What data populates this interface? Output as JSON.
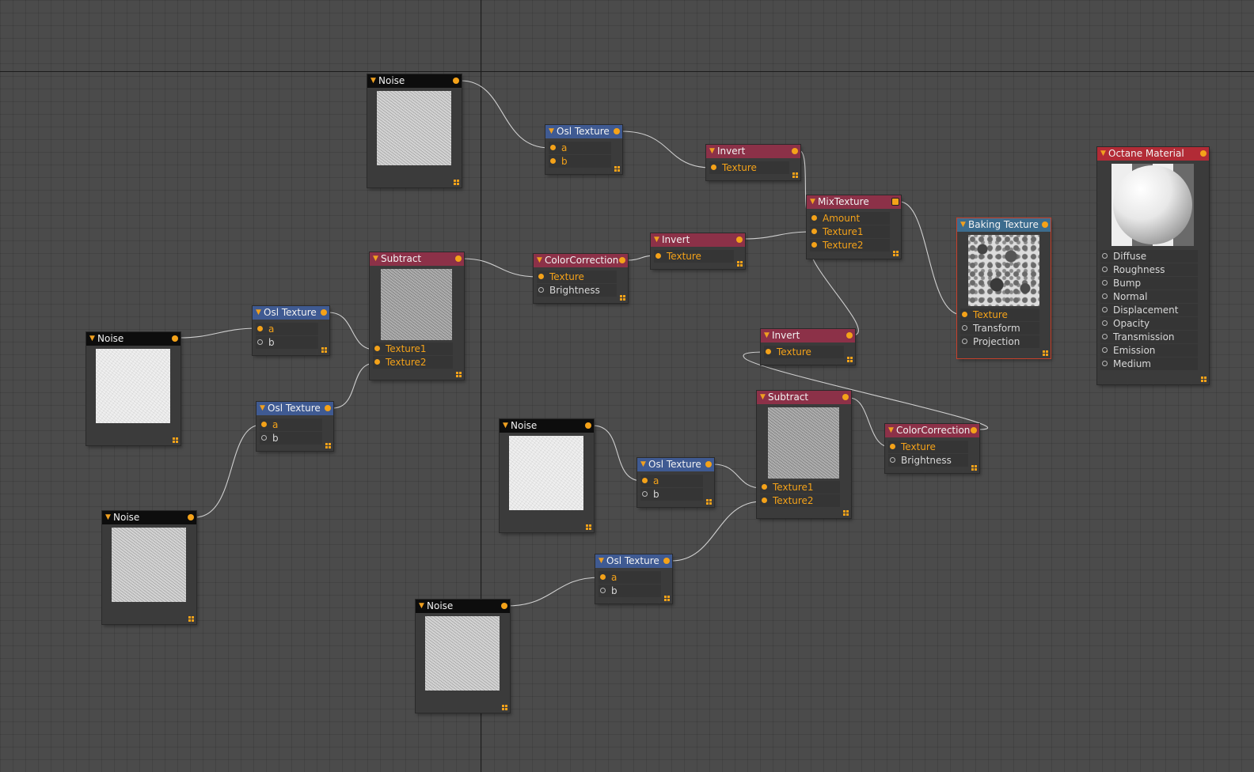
{
  "nodes": {
    "noise_a": {
      "title": "Noise"
    },
    "noise_b": {
      "title": "Noise"
    },
    "noise_c": {
      "title": "Noise"
    },
    "noise_d": {
      "title": "Noise"
    },
    "noise_e": {
      "title": "Noise"
    },
    "osl_top": {
      "title": "Osl Texture",
      "inputs": [
        "a",
        "b"
      ]
    },
    "osl_left1": {
      "title": "Osl Texture",
      "inputs": [
        "a",
        "b"
      ]
    },
    "osl_left2": {
      "title": "Osl Texture",
      "inputs": [
        "a",
        "b"
      ]
    },
    "osl_mid": {
      "title": "Osl Texture",
      "inputs": [
        "a",
        "b"
      ]
    },
    "osl_bottom": {
      "title": "Osl Texture",
      "inputs": [
        "a",
        "b"
      ]
    },
    "subtract_left": {
      "title": "Subtract",
      "inputs": [
        "Texture1",
        "Texture2"
      ]
    },
    "subtract_right": {
      "title": "Subtract",
      "inputs": [
        "Texture1",
        "Texture2"
      ]
    },
    "colorcorr_left": {
      "title": "ColorCorrection",
      "inputs": [
        "Texture",
        "Brightness"
      ]
    },
    "colorcorr_right": {
      "title": "ColorCorrection",
      "inputs": [
        "Texture",
        "Brightness"
      ]
    },
    "invert_top": {
      "title": "Invert",
      "inputs": [
        "Texture"
      ]
    },
    "invert_mid": {
      "title": "Invert",
      "inputs": [
        "Texture"
      ]
    },
    "invert_low": {
      "title": "Invert",
      "inputs": [
        "Texture"
      ]
    },
    "mixtexture": {
      "title": "MixTexture",
      "inputs": [
        "Amount",
        "Texture1",
        "Texture2"
      ]
    },
    "baking": {
      "title": "Baking Texture",
      "inputs": [
        "Texture",
        "Transform",
        "Projection"
      ]
    },
    "material": {
      "title": "Octane Material",
      "inputs": [
        "Diffuse",
        "Roughness",
        "Bump",
        "Normal",
        "Displacement",
        "Opacity",
        "Transmission",
        "Emission",
        "Medium"
      ]
    }
  },
  "icons": {
    "collapse": "triangle-down-icon",
    "output": "output-port-icon",
    "resize": "resize-grip-icon"
  },
  "colors": {
    "canvas": "#4b4b4b",
    "wire": "#cfcfcf",
    "port": "#f4a219",
    "header_noise": "#0d0d0d",
    "header_osl": "#3f5a92",
    "header_math": "#8c3148",
    "header_baking": "#3c6c8e",
    "header_material": "#b22b36"
  }
}
